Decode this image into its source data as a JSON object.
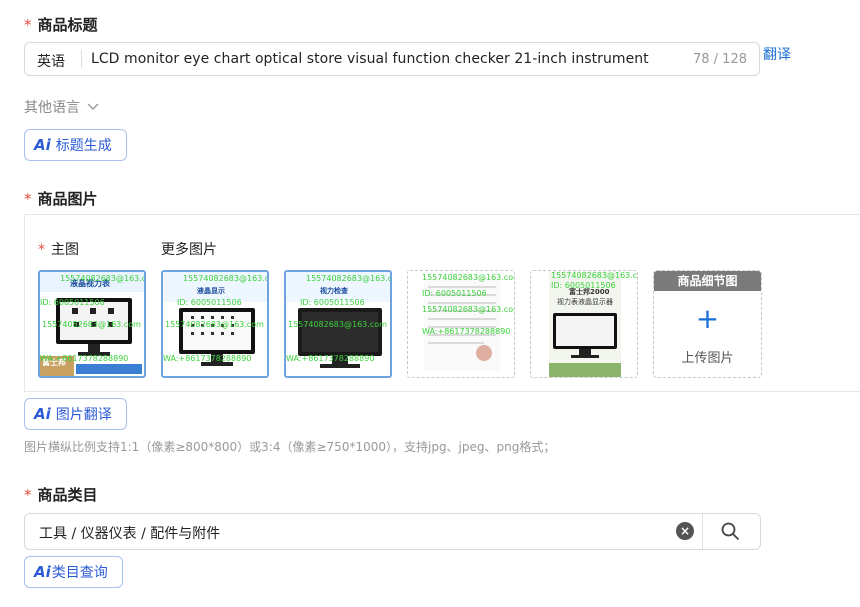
{
  "product_title": {
    "label": "商品标题",
    "language": "英语",
    "value": "LCD monitor eye chart optical store visual function checker 21-inch instrument",
    "counter": "78 / 128",
    "translate_link": "翻译",
    "other_languages": "其他语言",
    "ai_button": "标题生成"
  },
  "product_images": {
    "label": "商品图片",
    "main_label": "主图",
    "more_label": "更多图片",
    "watermarks": {
      "email": "15574082683@163.com",
      "id": "ID: 6005011506",
      "phone": "WA:+8617378288890"
    },
    "thumb_captions": [
      "液晶视力表",
      "液晶显示",
      "视力检查",
      "富士邦2000",
      "视力表液晶显示器",
      "富士邦"
    ],
    "detail_header": "商品细节图",
    "upload_label": "上传图片",
    "ai_button": "图片翻译",
    "hint": "图片横纵比例支持1:1（像素≥800*800）或3:4（像素≥750*1000），支持jpg、jpeg、png格式；"
  },
  "product_category": {
    "label": "商品类目",
    "value": "工具 / 仪器仪表 / 配件与附件",
    "ai_button": "类目查询"
  },
  "colors": {
    "accent": "#1a6fd6",
    "required": "#e54d42",
    "ai_text": "#2d5bd7"
  }
}
